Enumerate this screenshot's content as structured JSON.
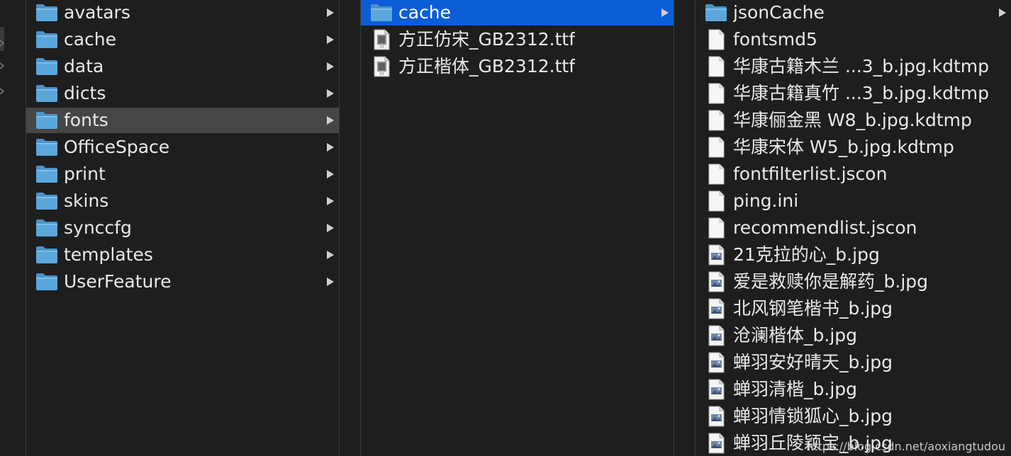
{
  "columns": {
    "fonts_parent": [
      {
        "name": "avatars",
        "type": "folder"
      },
      {
        "name": "cache",
        "type": "folder"
      },
      {
        "name": "data",
        "type": "folder"
      },
      {
        "name": "dicts",
        "type": "folder"
      },
      {
        "name": "fonts",
        "type": "folder",
        "selected": "inactive"
      },
      {
        "name": "OfficeSpace",
        "type": "folder"
      },
      {
        "name": "print",
        "type": "folder"
      },
      {
        "name": "skins",
        "type": "folder"
      },
      {
        "name": "synccfg",
        "type": "folder"
      },
      {
        "name": "templates",
        "type": "folder"
      },
      {
        "name": "UserFeature",
        "type": "folder"
      }
    ],
    "fonts": [
      {
        "name": "cache",
        "type": "folder",
        "selected": "active"
      },
      {
        "name": "方正仿宋_GB2312.ttf",
        "type": "font"
      },
      {
        "name": "方正楷体_GB2312.ttf",
        "type": "font"
      }
    ],
    "cache": [
      {
        "name": "jsonCache",
        "type": "folder"
      },
      {
        "name": "fontsmd5",
        "type": "document"
      },
      {
        "name": "华康古籍木兰 ...3_b.jpg.kdtmp",
        "type": "document"
      },
      {
        "name": "华康古籍真竹 ...3_b.jpg.kdtmp",
        "type": "document"
      },
      {
        "name": "华康俪金黑 W8_b.jpg.kdtmp",
        "type": "document"
      },
      {
        "name": "华康宋体 W5_b.jpg.kdtmp",
        "type": "document"
      },
      {
        "name": "fontfilterlist.jscon",
        "type": "document"
      },
      {
        "name": "ping.ini",
        "type": "document"
      },
      {
        "name": "recommendlist.jscon",
        "type": "document"
      },
      {
        "name": "21克拉的心_b.jpg",
        "type": "image"
      },
      {
        "name": "爱是救赎你是解药_b.jpg",
        "type": "image"
      },
      {
        "name": "北风钢笔楷书_b.jpg",
        "type": "image"
      },
      {
        "name": "沧澜楷体_b.jpg",
        "type": "image"
      },
      {
        "name": "蝉羽安好晴天_b.jpg",
        "type": "image"
      },
      {
        "name": "蝉羽清楷_b.jpg",
        "type": "image"
      },
      {
        "name": "蝉羽情锁狐心_b.jpg",
        "type": "image"
      },
      {
        "name": "蝉羽丘陵颖宝_b.jpg",
        "type": "image"
      }
    ]
  },
  "watermark": "https://blog.csdn.net/aoxiangtudou",
  "colors": {
    "background": "#1e1e1e",
    "selection_active": "#0b5ed7",
    "selection_inactive": "#464646",
    "folder": "#5aa7dc",
    "text": "#e9e9e9",
    "chevron": "#cfcfcf"
  },
  "icons": {
    "folder": "folder-icon",
    "font": "font-file-icon",
    "document": "document-icon",
    "image": "image-file-icon",
    "arrow": "chevron-right-icon"
  }
}
